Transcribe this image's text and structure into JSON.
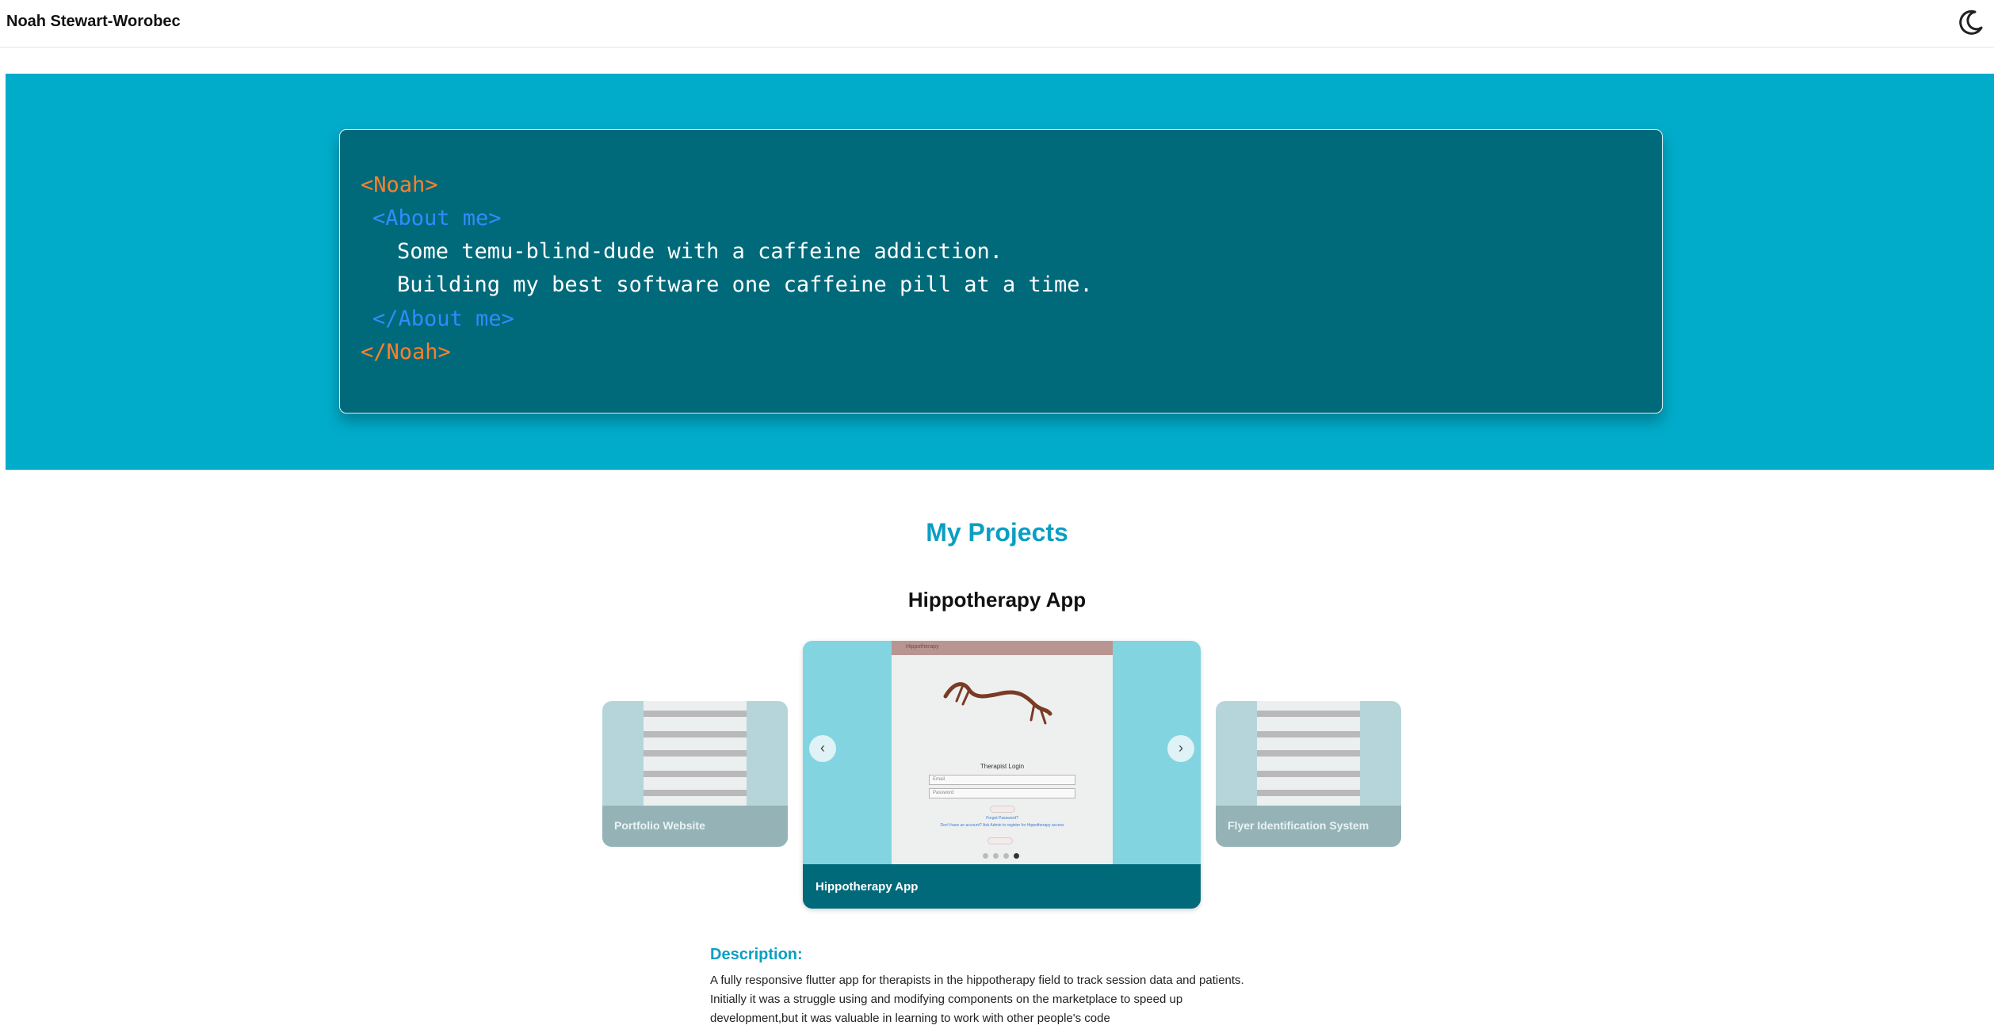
{
  "header": {
    "site_name": "Noah Stewart-Worobec",
    "theme_toggle_icon": "moon-icon"
  },
  "hero": {
    "outer_open": "<Noah>",
    "inner_open": "<About me>",
    "bio_line1": "Some temu-blind-dude with a caffeine addiction.",
    "bio_line2": "Building my best software one caffeine pill at a time.",
    "inner_close": "</About me>",
    "outer_close": "</Noah>"
  },
  "projects": {
    "section_title": "My Projects",
    "current_title": "Hippotherapy App",
    "carousel": {
      "prev_icon": "chevron-left-icon",
      "next_icon": "chevron-right-icon",
      "prev_label": "‹",
      "next_label": "›",
      "cards": [
        {
          "caption": "Portfolio Website"
        },
        {
          "caption": "Hippotherapy App"
        },
        {
          "caption": "Flyer Identification System"
        }
      ],
      "screenshot": {
        "app_bar": "Hippotherapy",
        "title": "Therapist Login",
        "email_placeholder": "Email",
        "password_placeholder": "Password",
        "login": "Login",
        "forgot": "Forgot Password?",
        "signup": "Don't have an account? Ask Admin to register for Hippotherapy access",
        "guest": "Log in as Guest"
      }
    },
    "description": {
      "heading": "Description:",
      "lines": [
        "A fully responsive flutter app for therapists in the hippotherapy field to track session data and patients.",
        "Initially it was a struggle using and modifying components on the marketplace to speed up",
        "development,but it was valuable in learning to work with other people's code"
      ]
    }
  }
}
